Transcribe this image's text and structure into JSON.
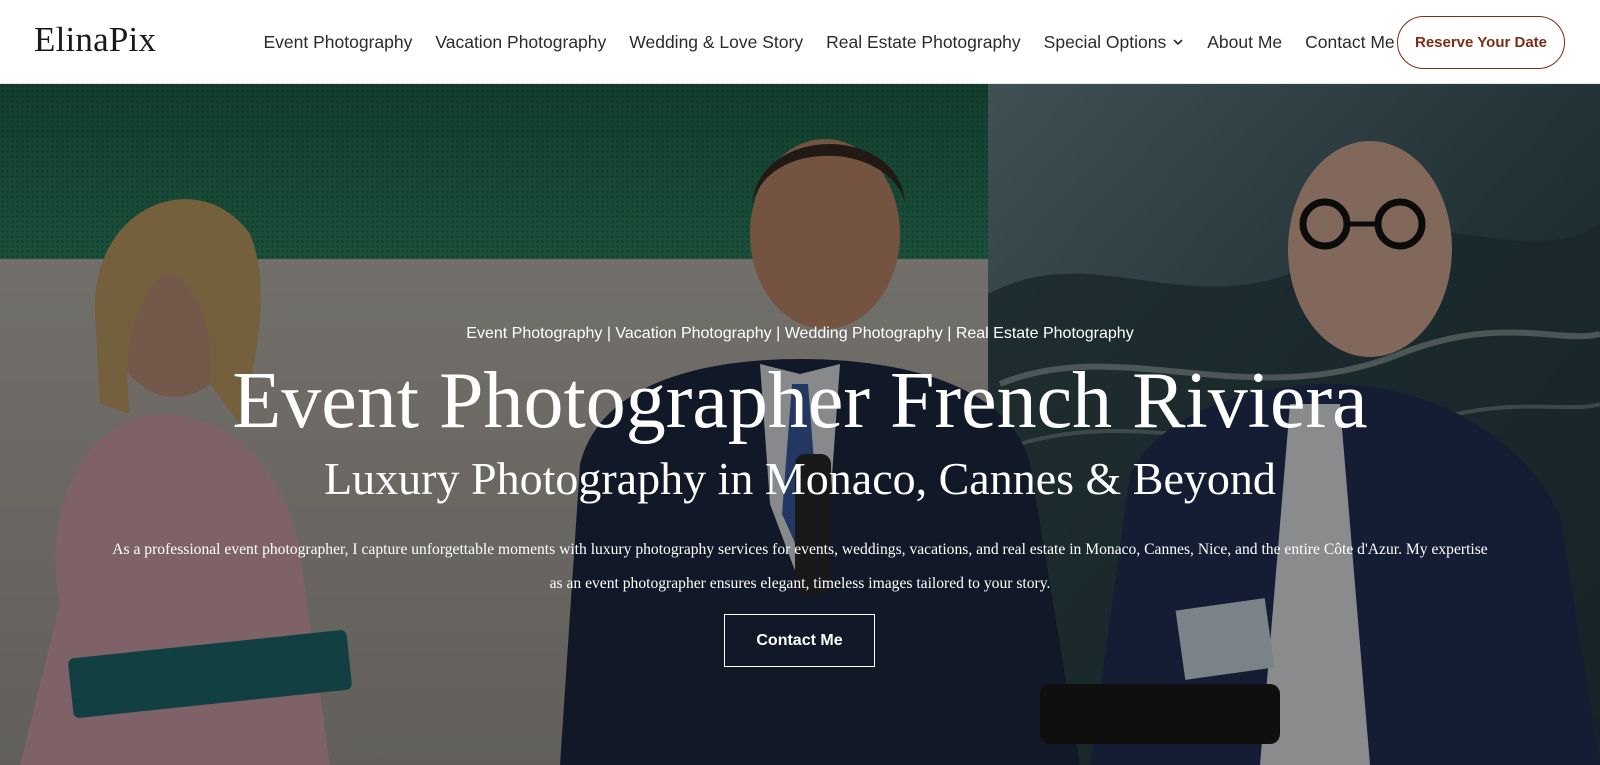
{
  "brand": {
    "logo_text": "ElinaPix"
  },
  "nav": {
    "items": [
      {
        "label": "Event Photography"
      },
      {
        "label": "Vacation Photography"
      },
      {
        "label": "Wedding & Love Story"
      },
      {
        "label": "Real Estate Photography"
      },
      {
        "label": "Special Options",
        "has_dropdown": true
      },
      {
        "label": "About Me"
      },
      {
        "label": "Contact Me"
      }
    ],
    "cta_label": "Reserve Your Date"
  },
  "hero": {
    "eyebrow": "Event Photography | Vacation Photography | Wedding Photography | Real Estate Photography",
    "title": "Event Photographer French Riviera",
    "subtitle": "Luxury Photography in Monaco, Cannes & Beyond",
    "description": "As a professional event photographer, I capture unforgettable moments with luxury photography services for events, weddings, vacations, and real estate in Monaco, Cannes, Nice, and the entire Côte d'Azur. My expertise as an event photographer ensures elegant, timeless images tailored to your story.",
    "button_label": "Contact Me",
    "background_description_icon": "conference-panel-photo"
  },
  "colors": {
    "accent": "#7a2e14",
    "header_bg": "#ffffff",
    "nav_text": "#2b2b2b",
    "hero_text": "#ffffff"
  }
}
